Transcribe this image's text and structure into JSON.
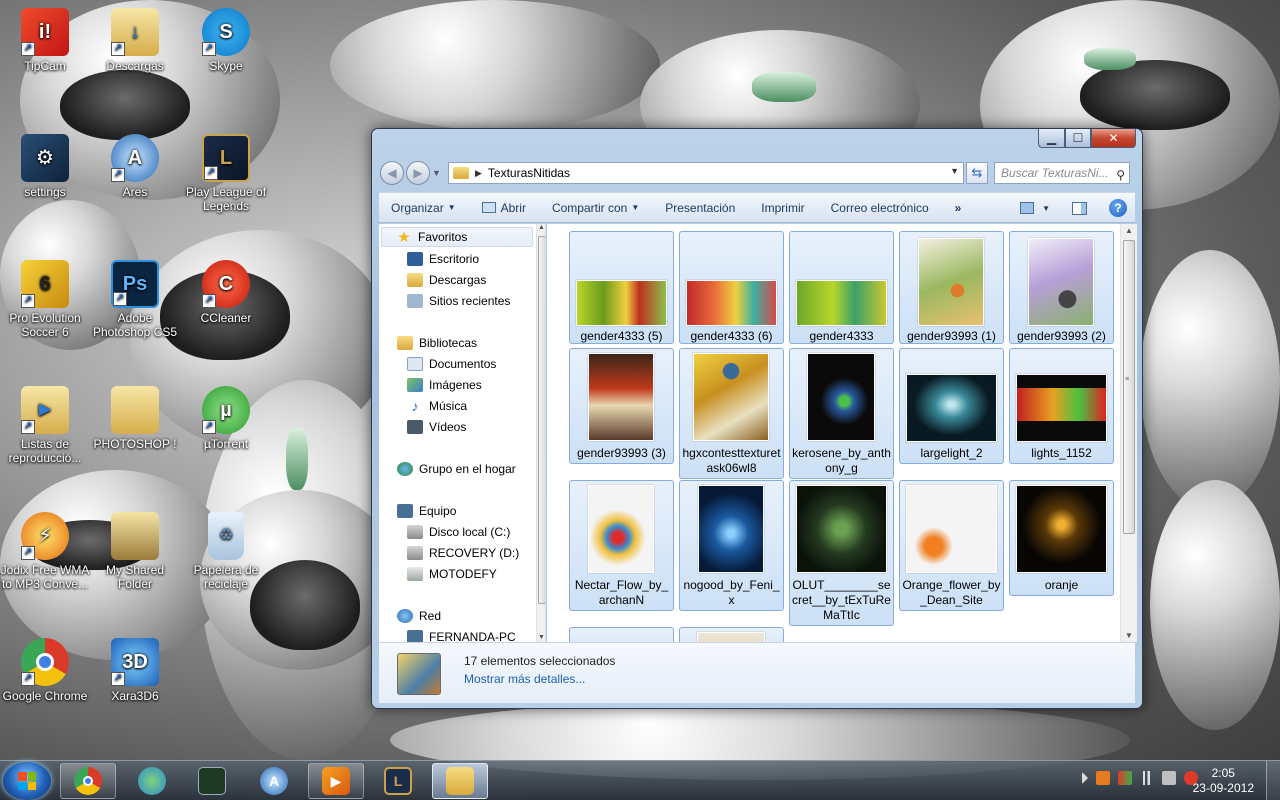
{
  "desktop": {
    "icons": [
      {
        "label": "TipCam",
        "icon": "tipcam-icon"
      },
      {
        "label": "Descargas",
        "icon": "downloads-folder-icon"
      },
      {
        "label": "Skype",
        "icon": "skype-icon"
      },
      {
        "label": "settings",
        "icon": "settings-icon"
      },
      {
        "label": "Ares",
        "icon": "ares-icon"
      },
      {
        "label": "Play League of Legends",
        "icon": "league-of-legends-icon"
      },
      {
        "label": "Pro Evolution Soccer 6",
        "icon": "pes6-icon"
      },
      {
        "label": "Adobe Photoshop CS5",
        "icon": "photoshop-icon"
      },
      {
        "label": "CCleaner",
        "icon": "ccleaner-icon"
      },
      {
        "label": "Listas de reproducció...",
        "icon": "playlist-icon"
      },
      {
        "label": "PHOTOSHOP !",
        "icon": "folder-icon"
      },
      {
        "label": "µTorrent",
        "icon": "utorrent-icon"
      },
      {
        "label": "Jodix Free WMA to MP3 Conve...",
        "icon": "jodix-icon"
      },
      {
        "label": "My Shared Folder",
        "icon": "shared-folder-icon"
      },
      {
        "label": "Papelera de reciclaje",
        "icon": "recycle-bin-icon"
      },
      {
        "label": "Google Chrome",
        "icon": "chrome-icon"
      },
      {
        "label": "Xara3D6",
        "icon": "xara3d-icon"
      }
    ]
  },
  "explorer": {
    "address": {
      "path": "TexturasNitidas"
    },
    "search": {
      "placeholder": "Buscar TexturasNi..."
    },
    "toolbar": {
      "organize": "Organizar",
      "open": "Abrir",
      "share": "Compartir con",
      "slideshow": "Presentación",
      "print": "Imprimir",
      "email": "Correo electrónico",
      "more": "»"
    },
    "nav": {
      "favorites": "Favoritos",
      "desktop": "Escritorio",
      "downloads": "Descargas",
      "recent": "Sitios recientes",
      "libraries": "Bibliotecas",
      "documents": "Documentos",
      "images": "Imágenes",
      "music": "Música",
      "videos": "Vídeos",
      "homegroup": "Grupo en el hogar",
      "computer": "Equipo",
      "local_disk": "Disco local (C:)",
      "recovery": "RECOVERY (D:)",
      "motodefy": "MOTODEFY",
      "network": "Red",
      "fernanda_pc": "FERNANDA-PC"
    },
    "files": [
      {
        "name": "gender4333 (5)"
      },
      {
        "name": "gender4333 (6)"
      },
      {
        "name": "gender4333"
      },
      {
        "name": "gender93993 (1)"
      },
      {
        "name": "gender93993 (2)"
      },
      {
        "name": "gender93993 (3)"
      },
      {
        "name": "hgxcontesttexturetask06wl8"
      },
      {
        "name": "kerosene_by_anthony_g"
      },
      {
        "name": "largelight_2"
      },
      {
        "name": "lights_1152"
      },
      {
        "name": "Nectar_Flow_by_archanN"
      },
      {
        "name": "nogood_by_Feni_x"
      },
      {
        "name": "OLUT________secret__by_tExTuReMaTtIc"
      },
      {
        "name": "Orange_flower_by_Dean_Site"
      },
      {
        "name": "oranje"
      }
    ],
    "details": {
      "count": "17 elementos seleccionados",
      "more": "Mostrar más detalles..."
    }
  },
  "taskbar": {
    "time": "2:05",
    "date": "23-09-2012",
    "apps": [
      "chrome-icon",
      "messenger-icon",
      "task-manager-icon",
      "ares-icon",
      "media-player-icon",
      "league-of-legends-icon",
      "windows-explorer-icon"
    ]
  }
}
